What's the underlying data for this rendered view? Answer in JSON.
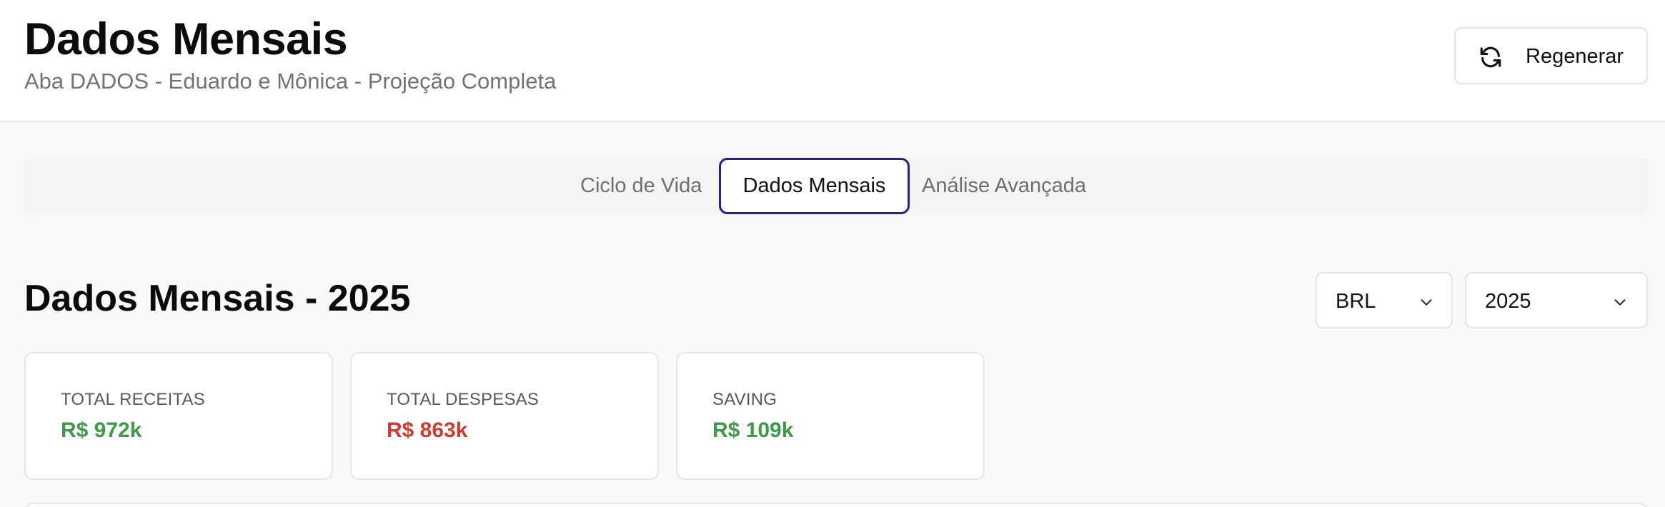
{
  "header": {
    "title": "Dados Mensais",
    "subtitle": "Aba DADOS - Eduardo e Mônica - Projeção Completa",
    "regenerate_label": "Regenerar",
    "regenerate_icon": "refresh-icon"
  },
  "tabs": [
    {
      "label": "Ciclo de Vida",
      "active": false
    },
    {
      "label": "Dados Mensais",
      "active": true
    },
    {
      "label": "Análise Avançada",
      "active": false
    }
  ],
  "section": {
    "title": "Dados Mensais - 2025",
    "currency_select": {
      "value": "BRL"
    },
    "year_select": {
      "value": "2025"
    }
  },
  "summary_cards": [
    {
      "label": "TOTAL RECEITAS",
      "value": "R$ 972k",
      "color": "#3f9a4a"
    },
    {
      "label": "TOTAL DESPESAS",
      "value": "R$ 863k",
      "color": "#d13b33"
    },
    {
      "label": "SAVING",
      "value": "R$ 109k",
      "color": "#3f9a4a"
    }
  ],
  "colors": {
    "accent_tab_border": "#2d1f8a",
    "positive": "#3f9a4a",
    "negative": "#d13b33"
  }
}
